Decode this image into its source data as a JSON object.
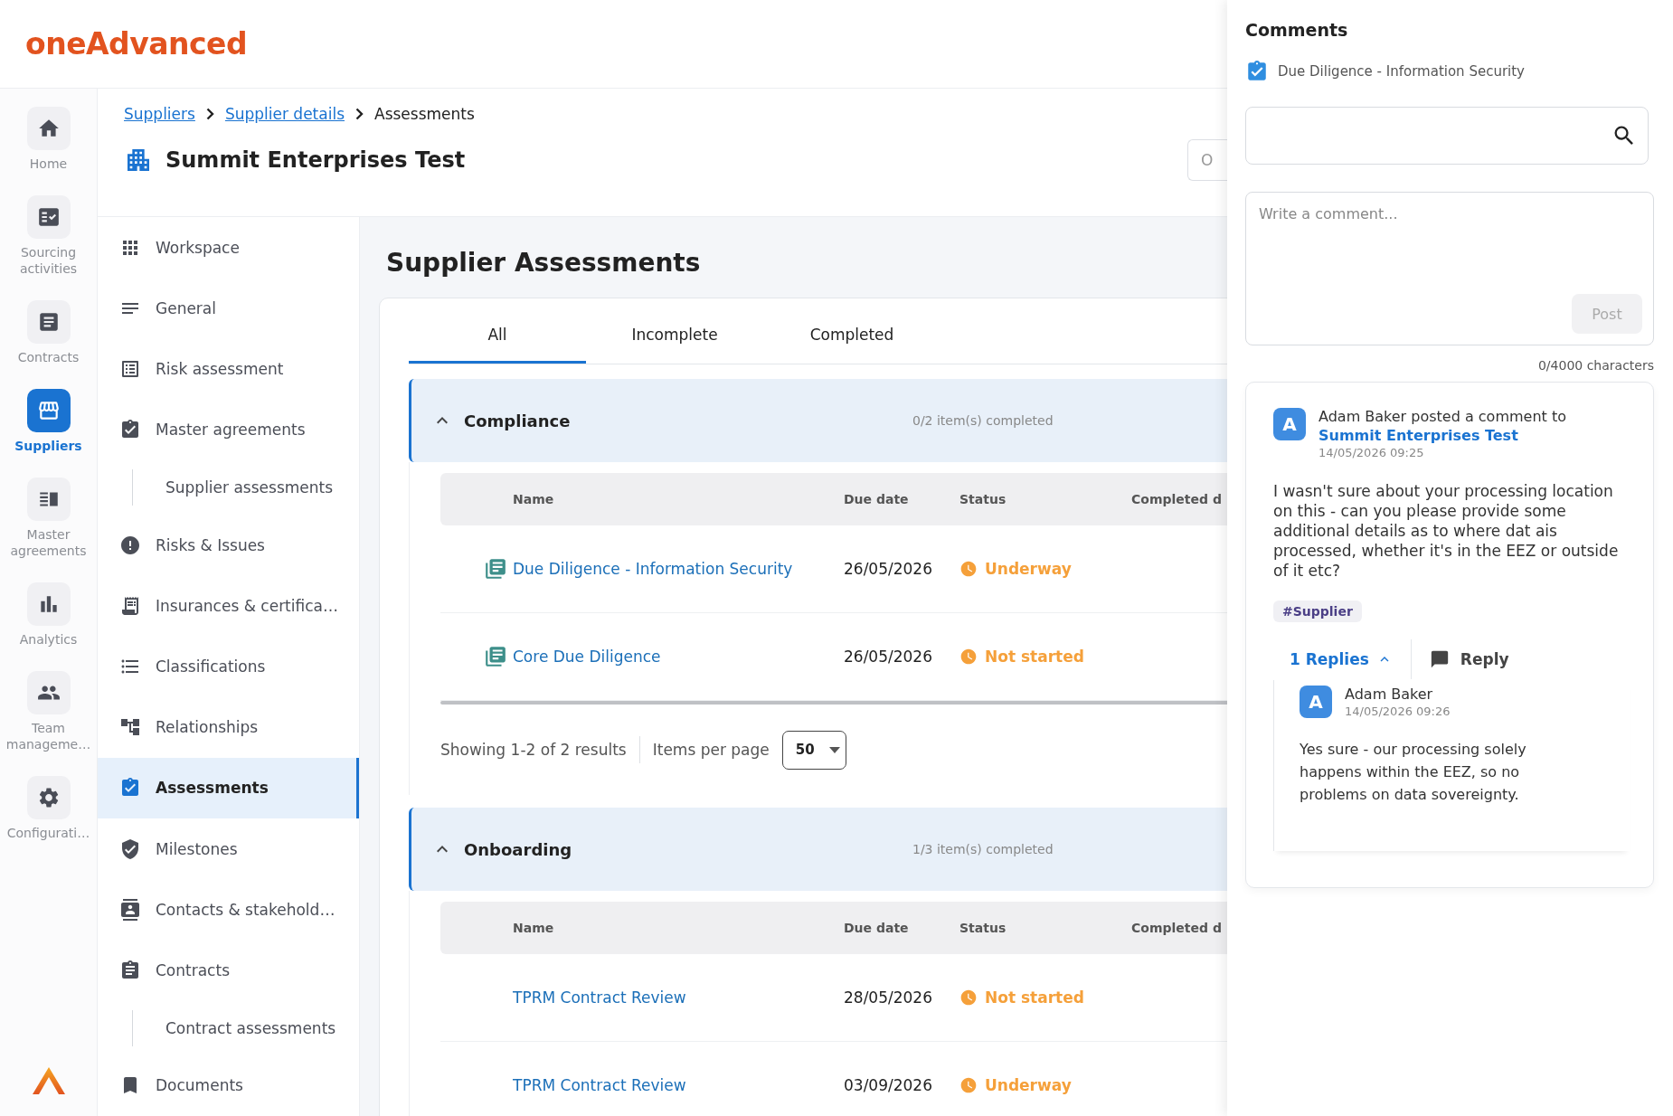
{
  "logo": {
    "text": "oneAdvanced"
  },
  "rail": [
    {
      "label": "Home",
      "selected": false
    },
    {
      "label": "Sourcing activities",
      "selected": false
    },
    {
      "label": "Contracts",
      "selected": false
    },
    {
      "label": "Suppliers",
      "selected": true
    },
    {
      "label": "Master agreements",
      "selected": false
    },
    {
      "label": "Analytics",
      "selected": false
    },
    {
      "label": "Team manageme…",
      "selected": false
    },
    {
      "label": "Configurati…",
      "selected": false
    }
  ],
  "breadcrumb": [
    {
      "label": "Suppliers",
      "kind": "link"
    },
    {
      "label": "Supplier details",
      "kind": "link"
    },
    {
      "label": "Assessments",
      "kind": "current"
    }
  ],
  "title": "Summit Enterprises Test",
  "header_button": "O",
  "sidebar": [
    {
      "label": "Workspace",
      "kind": "item",
      "selected": false
    },
    {
      "label": "General",
      "kind": "item",
      "selected": false
    },
    {
      "label": "Risk assessment",
      "kind": "item",
      "selected": false
    },
    {
      "label": "Master agreements",
      "kind": "item",
      "selected": false
    },
    {
      "label": "Supplier assessments",
      "kind": "subitem",
      "selected": false
    },
    {
      "label": "Risks & Issues",
      "kind": "item",
      "selected": false
    },
    {
      "label": "Insurances & certifica…",
      "kind": "item",
      "selected": false
    },
    {
      "label": "Classifications",
      "kind": "item",
      "selected": false
    },
    {
      "label": "Relationships",
      "kind": "item",
      "selected": false
    },
    {
      "label": "Assessments",
      "kind": "item",
      "selected": true
    },
    {
      "label": "Milestones",
      "kind": "item",
      "selected": false
    },
    {
      "label": "Contacts & stakehold…",
      "kind": "item",
      "selected": false
    },
    {
      "label": "Contracts",
      "kind": "item",
      "selected": false
    },
    {
      "label": "Contract assessments",
      "kind": "subitem",
      "selected": false
    },
    {
      "label": "Documents",
      "kind": "item",
      "selected": false
    }
  ],
  "heading": "Supplier Assessments",
  "tabs": [
    {
      "label": "All",
      "selected": true
    },
    {
      "label": "Incomplete",
      "selected": false
    },
    {
      "label": "Completed",
      "selected": false
    }
  ],
  "groups": [
    {
      "title": "Compliance",
      "progress": "0/2 item(s) completed",
      "expanded": true,
      "columns": [
        "Name",
        "Due date",
        "Status",
        "Completed d"
      ],
      "rows": [
        {
          "name": "Due Diligence - Information Security",
          "kind": "document",
          "due": "26/05/2026",
          "status": "Underway"
        },
        {
          "name": "Core Due Diligence",
          "kind": "document",
          "due": "26/05/2026",
          "status": "Not started"
        }
      ],
      "pagination": {
        "summary": "Showing 1-2 of 2 results",
        "label": "Items per page",
        "value": "50"
      }
    },
    {
      "title": "Onboarding",
      "progress": "1/3 item(s) completed",
      "expanded": true,
      "columns": [
        "Name",
        "Due date",
        "Status",
        "Completed d"
      ],
      "rows": [
        {
          "name": "TPRM Contract Review",
          "kind": "plain",
          "due": "28/05/2026",
          "status": "Not started"
        },
        {
          "name": "TPRM Contract Review",
          "kind": "plain",
          "due": "03/09/2026",
          "status": "Underway"
        }
      ]
    }
  ],
  "comments": {
    "title": "Comments",
    "context": {
      "label": "Due Diligence - Information Security",
      "checked": true
    },
    "composer": {
      "placeholder": "Write a comment...",
      "button": "Post",
      "button_disabled": true,
      "counter": "0/4000 characters"
    },
    "thread": {
      "avatar": "A",
      "author_line": "Adam Baker posted a comment to",
      "target": "Summit Enterprises Test",
      "time": "14/05/2026 09:25",
      "body": "I wasn't sure about your processing location on this - can you please provide some additional details as to where dat ais processed, whether it's in the EEZ or outside of it etc?",
      "tags": [
        "#Supplier"
      ],
      "replies_toggle": "1 Replies",
      "replies_expanded": true,
      "reply_button": "Reply",
      "replies": [
        {
          "avatar": "A",
          "author": "Adam Baker",
          "time": "14/05/2026 09:26",
          "body": "Yes sure - our processing solely happens within the EEZ, so no problems on data sovereignty."
        }
      ]
    }
  }
}
